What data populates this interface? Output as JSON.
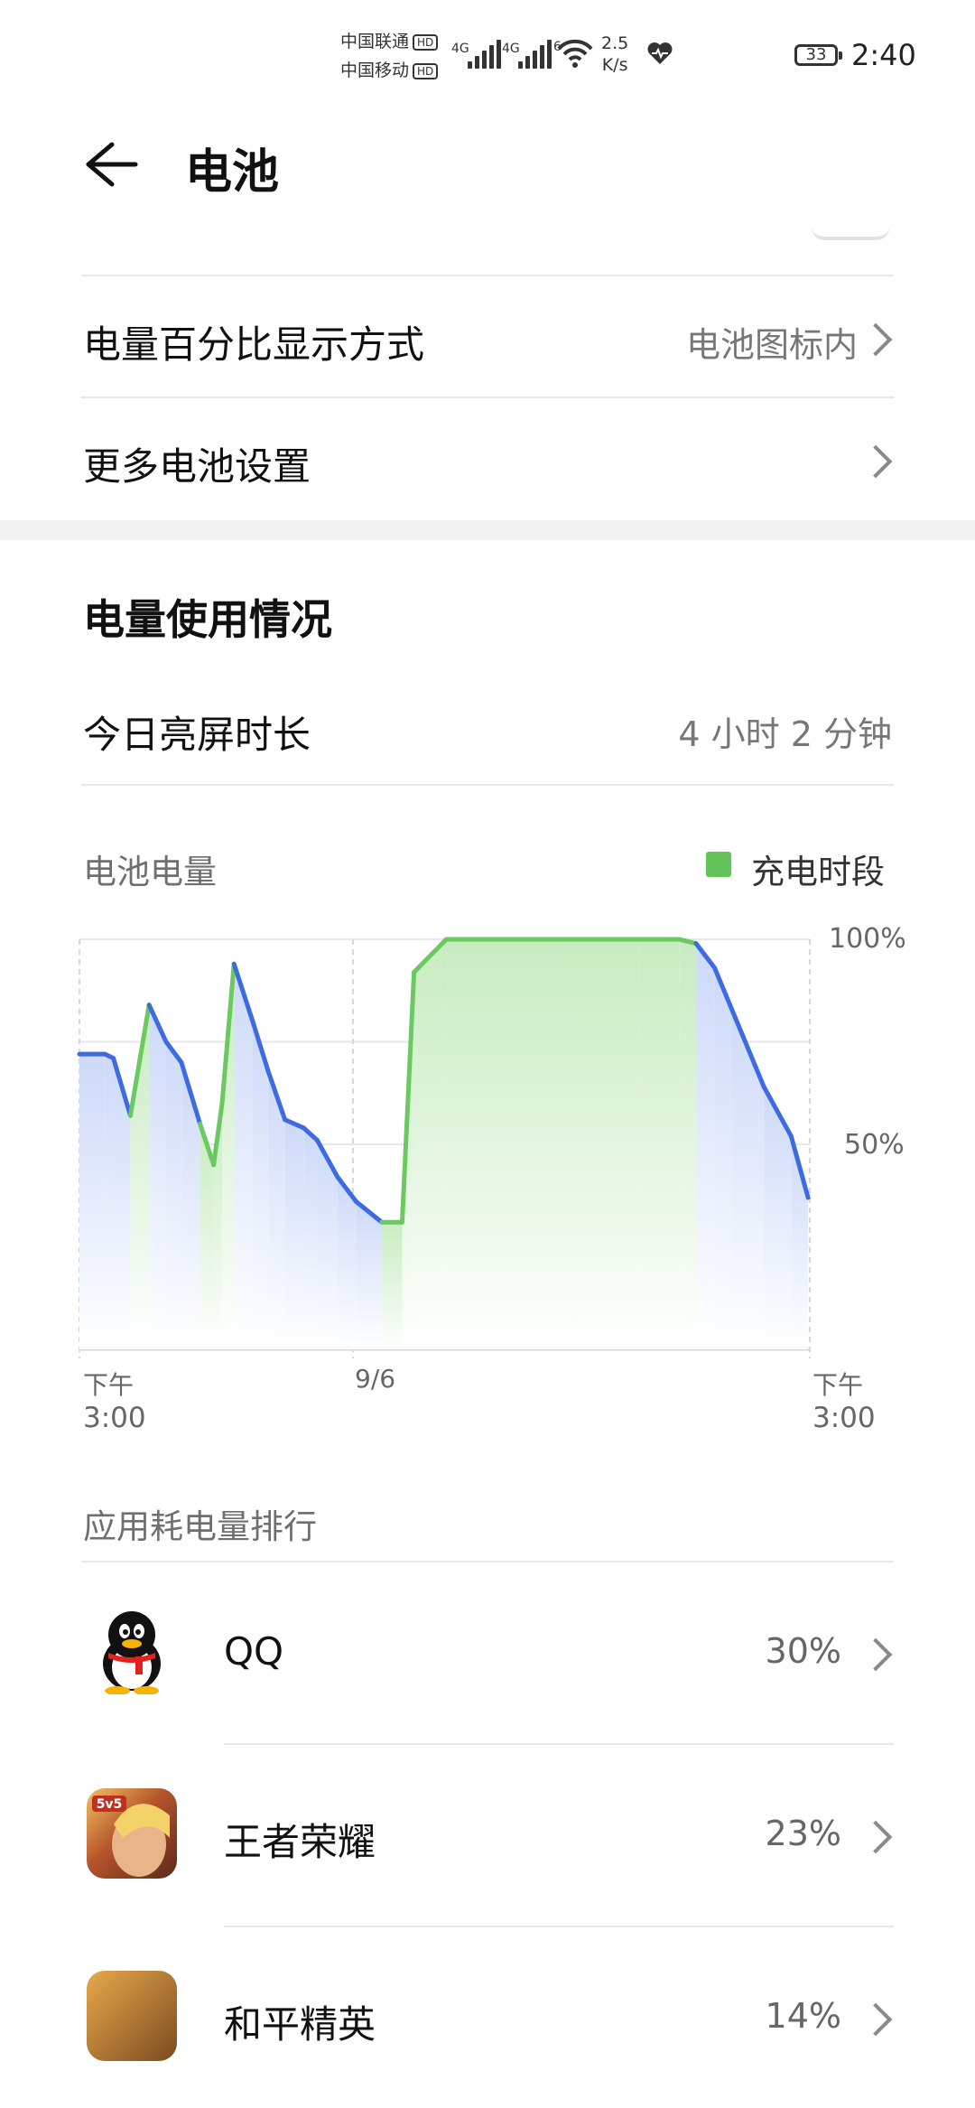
{
  "status_bar": {
    "carrier1": "中国联通",
    "carrier2": "中国移动",
    "hd": "HD",
    "net1": "4G",
    "net2": "4G",
    "wifi_tag": "6",
    "speed_value": "2.5",
    "speed_unit": "K/s",
    "battery_level": "33",
    "time": "2:40"
  },
  "header": {
    "title": "电池"
  },
  "settings": {
    "rows": [
      {
        "label": "电量百分比显示方式",
        "value": "电池图标内"
      },
      {
        "label": "更多电池设置",
        "value": ""
      }
    ]
  },
  "usage": {
    "section_title": "电量使用情况",
    "screen_time_label": "今日亮屏时长",
    "screen_time_value": "4 小时 2 分钟"
  },
  "chart_data": {
    "type": "line",
    "title": "电池电量",
    "legend": "充电时段",
    "x_ticks": [
      {
        "top": "下午",
        "bottom": "3:00"
      },
      {
        "top": "9/6",
        "bottom": ""
      },
      {
        "top": "下午",
        "bottom": "3:00"
      }
    ],
    "y_ticks": [
      "100%",
      "50%"
    ],
    "ylim": [
      0,
      100
    ],
    "colors": {
      "discharging": "#3e6be0",
      "charging": "#6cc860",
      "legend": "#63c45a"
    },
    "series": [
      {
        "values": [
          [
            0.0,
            72
          ],
          [
            1.5,
            72
          ],
          [
            2.0,
            71
          ],
          [
            3.0,
            57
          ],
          [
            4.1,
            84
          ],
          [
            5.1,
            75
          ],
          [
            6.0,
            70
          ],
          [
            7.1,
            55
          ],
          [
            7.9,
            45
          ],
          [
            8.4,
            60
          ],
          [
            9.1,
            94
          ],
          [
            10.2,
            80
          ],
          [
            11.1,
            68
          ],
          [
            12.1,
            56
          ],
          [
            13.2,
            54
          ],
          [
            14.0,
            51
          ],
          [
            15.2,
            42
          ],
          [
            16.3,
            36
          ],
          [
            17.8,
            31
          ],
          [
            19.0,
            31
          ],
          [
            19.7,
            92
          ],
          [
            21.6,
            100
          ],
          [
            33.0,
            100
          ],
          [
            35.3,
            100
          ],
          [
            36.3,
            99
          ],
          [
            37.4,
            93
          ],
          [
            38.4,
            83
          ],
          [
            40.3,
            64
          ],
          [
            41.9,
            52
          ],
          [
            42.9,
            37
          ]
        ],
        "charging_intervals": [
          [
            3.0,
            4.1
          ],
          [
            7.1,
            9.1
          ],
          [
            17.8,
            36.3
          ]
        ]
      }
    ]
  },
  "ranking": {
    "title": "应用耗电量排行",
    "apps": [
      {
        "name": "QQ",
        "percent": "30%",
        "icon": "qq-icon"
      },
      {
        "name": "王者荣耀",
        "percent": "23%",
        "icon": "honor-of-kings-icon",
        "icon_text": "5v5"
      },
      {
        "name": "和平精英",
        "percent": "14%",
        "icon": "game-for-peace-icon"
      }
    ]
  }
}
